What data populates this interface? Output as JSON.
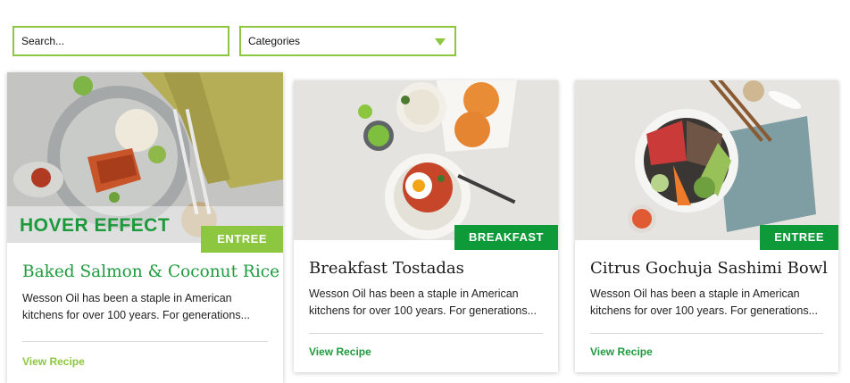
{
  "search": {
    "placeholder": "Search..."
  },
  "filter": {
    "selected": "Categories"
  },
  "hover_label": "HOVER EFFECT",
  "colors": {
    "accent_light_green": "#8dc63f",
    "accent_green": "#1f9c3f",
    "badge_dark_green": "#0f9a3a"
  },
  "cards": [
    {
      "badge": "ENTREE",
      "title": "Baked Salmon & Coconut Rice",
      "description": "Wesson Oil has been a staple in American kitchens for over 100 years. For generations...",
      "link": "View Recipe"
    },
    {
      "badge": "BREAKFAST",
      "title": "Breakfast Tostadas",
      "description": "Wesson Oil has been a staple in American kitchens for over 100 years. For generations...",
      "link": "View Recipe"
    },
    {
      "badge": "ENTREE",
      "title": "Citrus Gochuja Sashimi Bowl",
      "description": "Wesson Oil has been a staple in American kitchens for over 100 years. For generations...",
      "link": "View Recipe"
    }
  ]
}
